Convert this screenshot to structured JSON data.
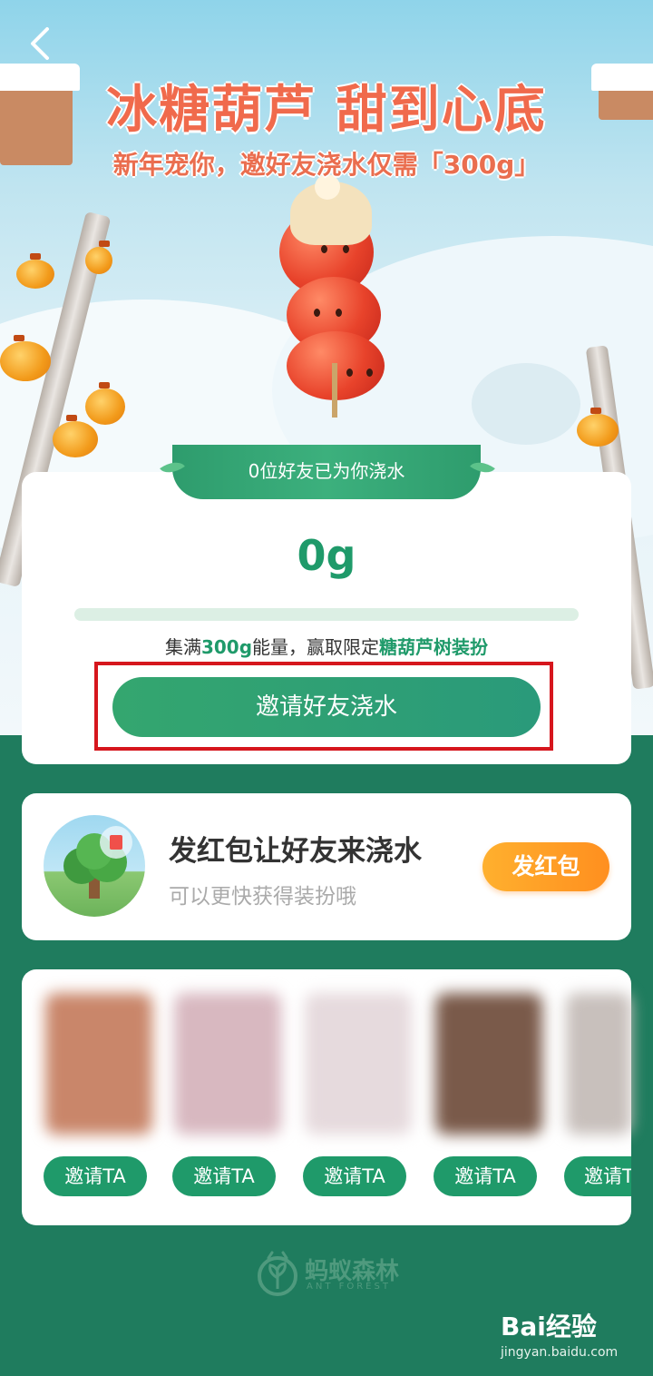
{
  "header": {
    "title": "冰糖葫芦 甜到心底",
    "subtitle": "新年宠你，邀好友浇水仅需「300g」"
  },
  "progress_card": {
    "ribbon_text": "0位好友已为你浇水",
    "grams": "0g",
    "progress_fraction": 0,
    "hint_prefix": "集满",
    "hint_amount": "300g",
    "hint_middle": "能量，赢取限定",
    "hint_reward": "糖葫芦树装扮",
    "invite_button": "邀请好友浇水"
  },
  "hongbao_card": {
    "title": "发红包让好友来浇水",
    "subtitle": "可以更快获得装扮哦",
    "button": "发红包"
  },
  "friends": {
    "invite_labels": [
      "邀请TA",
      "邀请TA",
      "邀请TA",
      "邀请TA",
      "邀请T"
    ]
  },
  "footer": {
    "logo_text": "蚂蚁森林",
    "logo_en": "ANT FOREST"
  },
  "watermark": {
    "brand": "Bai经验",
    "url": "jingyan.baidu.com"
  },
  "colors": {
    "primary_green": "#1f9a6a",
    "page_bg": "#1f7c5e",
    "title_red": "#f06a4c",
    "hongbao_orange": "#ff9a26",
    "highlight_box": "#d6161d"
  }
}
